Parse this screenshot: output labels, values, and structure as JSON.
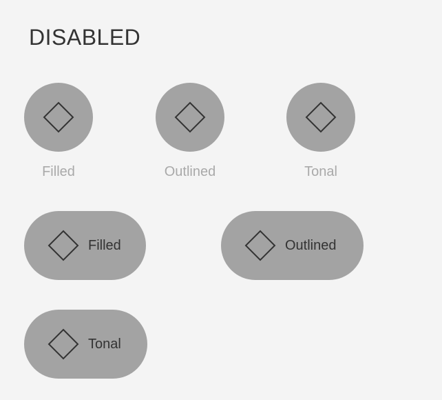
{
  "section": {
    "title": "DISABLED"
  },
  "icon_buttons": [
    {
      "label": "Filled",
      "icon": "diamond-icon"
    },
    {
      "label": "Outlined",
      "icon": "diamond-icon"
    },
    {
      "label": "Tonal",
      "icon": "diamond-icon"
    }
  ],
  "extended_buttons": [
    {
      "label": "Filled",
      "icon": "diamond-icon"
    },
    {
      "label": "Outlined",
      "icon": "diamond-icon"
    },
    {
      "label": "Tonal",
      "icon": "diamond-icon"
    }
  ],
  "colors": {
    "background": "#f4f4f4",
    "button_fill": "#a3a3a3",
    "icon_stroke": "#333333",
    "disabled_label": "#a9a9a9",
    "heading": "#333333"
  },
  "state": "disabled"
}
